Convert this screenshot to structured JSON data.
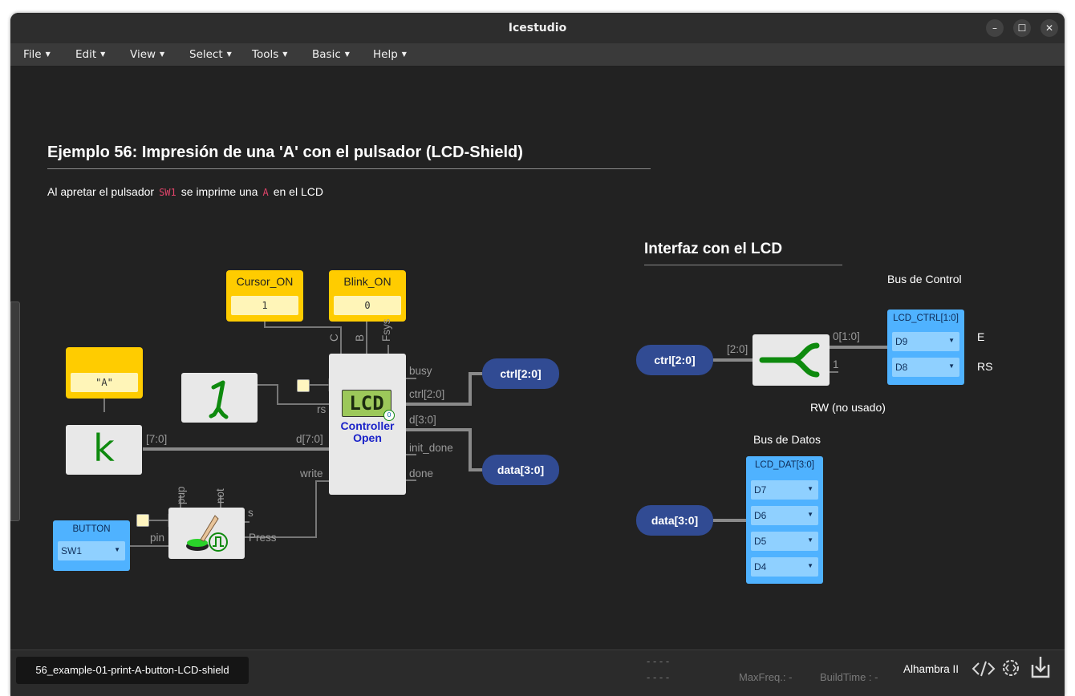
{
  "window": {
    "title": "Icestudio"
  },
  "menu": [
    {
      "label": "File",
      "caret": "▼"
    },
    {
      "label": "Edit",
      "caret": "▼"
    },
    {
      "label": "View",
      "caret": "▼"
    },
    {
      "label": "Select",
      "caret": "▼"
    },
    {
      "label": "Tools",
      "caret": "▼"
    },
    {
      "label": "Basic",
      "caret": "▼"
    },
    {
      "label": "Help",
      "caret": "▼"
    }
  ],
  "title": {
    "main": "Ejemplo 56: Impresión de una 'A' con el pulsador (LCD-Shield)"
  },
  "description": {
    "pre": "Al apretar el pulsador",
    "code1": "SW1",
    "mid": "se imprime una",
    "code2": "A",
    "post": "en el LCD"
  },
  "interface": {
    "heading": "Interfaz con el LCD",
    "bus_control": "Bus de Control",
    "bus_datos": "Bus de Datos",
    "rw_note": "RW (no usado)",
    "e_label": "E",
    "rs_label": "RS"
  },
  "constants": {
    "cursor": {
      "name": "Cursor_ON",
      "value": "1"
    },
    "blink": {
      "name": "Blink_ON",
      "value": "0"
    },
    "char": {
      "name": "",
      "value": "\"A\""
    }
  },
  "blocks": {
    "k_label": "k",
    "lcd_screen": "LCD",
    "lcd_name": "Controller Open",
    "lcd_badge": "0"
  },
  "ports": {
    "C": "C",
    "B": "B",
    "Fsys": "Fsys",
    "busy": "busy",
    "ctrl_out": "ctrl[2:0]",
    "rs": "rs",
    "d_out": "d[3:0]",
    "d_in": "d[7:0]",
    "k_out": "[7:0]",
    "init_done": "init_done",
    "done": "done",
    "write": "write",
    "pup": "pup",
    "not": "not",
    "s": "s",
    "pin": "pin",
    "press": "Press",
    "split_in": "[2:0]",
    "split_o1": "0[1:0]",
    "split_o2": "1"
  },
  "outputs": {
    "ctrl": "ctrl[2:0]",
    "data": "data[3:0]"
  },
  "inputs": {
    "ctrl": "ctrl[2:0]",
    "data": "data[3:0]"
  },
  "button_pin": {
    "title": "BUTTON",
    "value": "SW1",
    "caret": "▼"
  },
  "lcd_ctrl": {
    "title": "LCD_CTRL[1:0]",
    "pins": [
      "D9",
      "D8"
    ],
    "caret": "▼"
  },
  "lcd_dat": {
    "title": "LCD_DAT[3:0]",
    "pins": [
      "D7",
      "D6",
      "D5",
      "D4"
    ],
    "caret": "▼"
  },
  "status": {
    "filename": "56_example-01-print-A-button-LCD-shield",
    "dashes_row1": "-   -   -   -",
    "dashes_row2": "-   -   -   -",
    "maxfreq": "MaxFreq.:  -",
    "buildtime": "BuildTime :  -",
    "board": "Alhambra II"
  },
  "colors": {
    "constant": "#ffcc00",
    "pill": "#314b93",
    "pin": "#4fb2ff",
    "wire": "#777777",
    "bus": "#8a8a8a",
    "lcd_green": "#0e8a0e"
  }
}
